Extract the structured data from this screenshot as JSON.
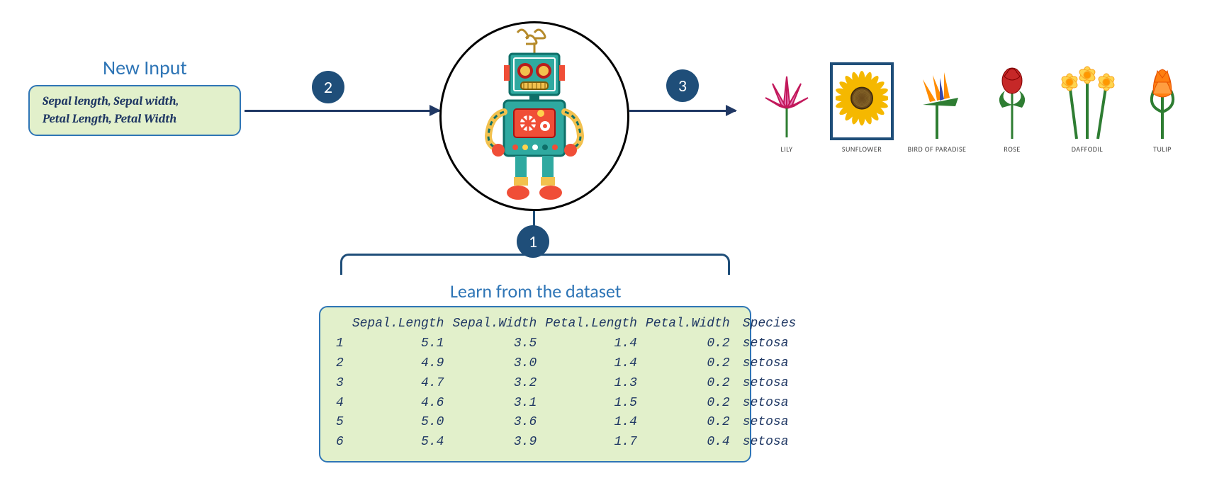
{
  "input": {
    "title": "New Input",
    "features_line1": "Sepal length, Sepal width,",
    "features_line2": "Petal Length, Petal Width"
  },
  "steps": {
    "learn": "1",
    "predict_input": "2",
    "predict_output": "3"
  },
  "learn_title": "Learn from the dataset",
  "dataset": {
    "columns": [
      "Sepal.Length",
      "Sepal.Width",
      "Petal.Length",
      "Petal.Width",
      "Species"
    ],
    "rows": [
      {
        "idx": "1",
        "sl": "5.1",
        "sw": "3.5",
        "pl": "1.4",
        "pw": "0.2",
        "sp": "setosa"
      },
      {
        "idx": "2",
        "sl": "4.9",
        "sw": "3.0",
        "pl": "1.4",
        "pw": "0.2",
        "sp": "setosa"
      },
      {
        "idx": "3",
        "sl": "4.7",
        "sw": "3.2",
        "pl": "1.3",
        "pw": "0.2",
        "sp": "setosa"
      },
      {
        "idx": "4",
        "sl": "4.6",
        "sw": "3.1",
        "pl": "1.5",
        "pw": "0.2",
        "sp": "setosa"
      },
      {
        "idx": "5",
        "sl": "5.0",
        "sw": "3.6",
        "pl": "1.4",
        "pw": "0.2",
        "sp": "setosa"
      },
      {
        "idx": "6",
        "sl": "5.4",
        "sw": "3.9",
        "pl": "1.7",
        "pw": "0.4",
        "sp": "setosa"
      }
    ]
  },
  "output": {
    "flowers": [
      {
        "name": "LILY"
      },
      {
        "name": "SUNFLOWER"
      },
      {
        "name": "BIRD OF PARADISE"
      },
      {
        "name": "ROSE"
      },
      {
        "name": "DAFFODIL"
      },
      {
        "name": "TULIP"
      }
    ],
    "selected_index": 1
  },
  "colors": {
    "accent": "#1f4e79",
    "link": "#2e75b6",
    "panel_bg": "#e2f0cb"
  }
}
